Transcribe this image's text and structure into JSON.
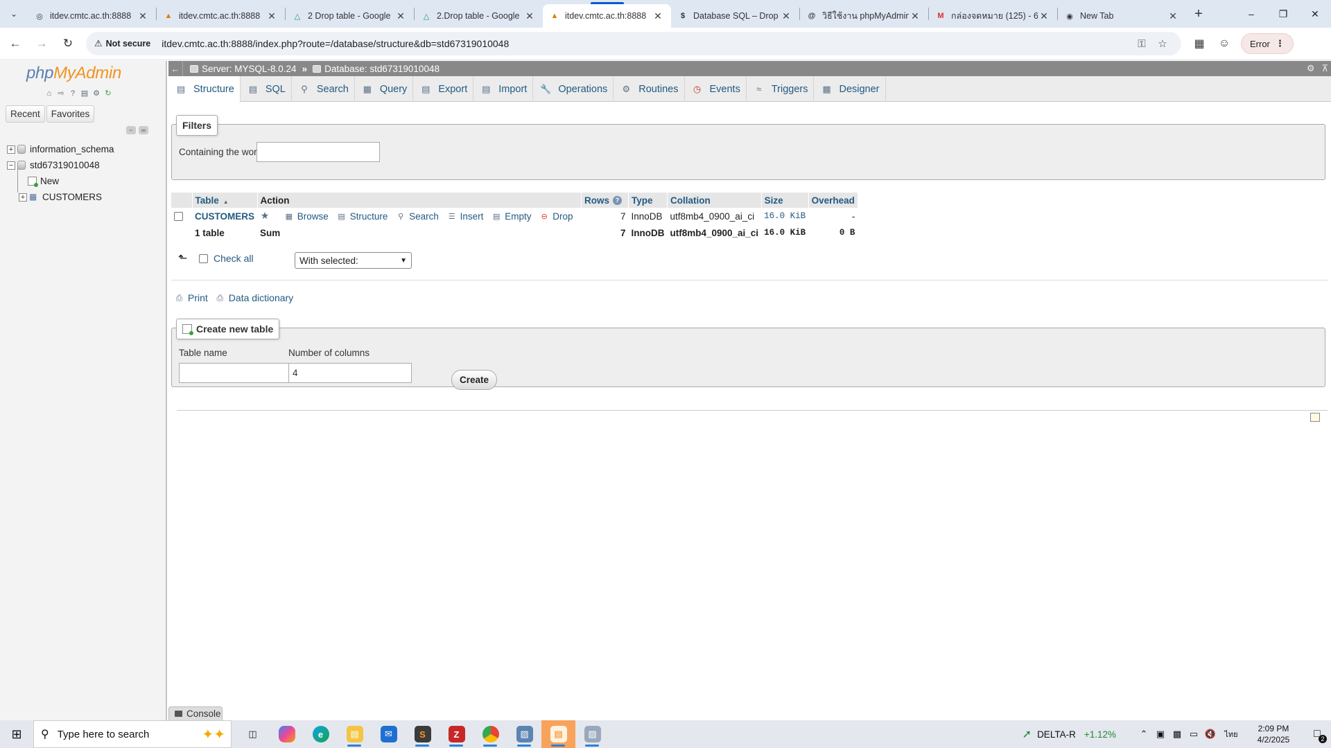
{
  "browser": {
    "tabs": [
      {
        "title": "itdev.cmtc.ac.th:8888",
        "icon": "globe-icon",
        "active": false
      },
      {
        "title": "itdev.cmtc.ac.th:8888",
        "icon": "pma-sail-icon",
        "active": false
      },
      {
        "title": "2 Drop table - Google",
        "icon": "google-drive-icon",
        "active": false
      },
      {
        "title": "2.Drop table - Google",
        "icon": "google-drive-icon",
        "active": false
      },
      {
        "title": "itdev.cmtc.ac.th:8888",
        "icon": "pma-sail-icon",
        "active": true
      },
      {
        "title": "Database SQL – Drop",
        "icon": "dollar-s-icon",
        "active": false
      },
      {
        "title": "วิธีใช้งาน phpMyAdmin",
        "icon": "threads-icon",
        "active": false
      },
      {
        "title": "กล่องจดหมาย (125) - 6",
        "icon": "gmail-icon",
        "active": false
      },
      {
        "title": "New Tab",
        "icon": "chrome-icon",
        "active": false
      }
    ],
    "security_label": "Not secure",
    "url": "itdev.cmtc.ac.th:8888/index.php?route=/database/structure&db=std67319010048",
    "error_label": "Error"
  },
  "pma": {
    "logo_php": "php",
    "logo_myadmin": "MyAdmin",
    "left_tabs": [
      "Recent",
      "Favorites"
    ],
    "tree": {
      "db1": "information_schema",
      "db2": "std67319010048",
      "new": "New",
      "table": "CUSTOMERS"
    },
    "breadcrumb": {
      "server": "Server: MYSQL-8.0.24",
      "database": "Database: std67319010048"
    },
    "menu": [
      {
        "label": "Structure",
        "icon": "structure-icon"
      },
      {
        "label": "SQL",
        "icon": "sql-icon"
      },
      {
        "label": "Search",
        "icon": "search-icon"
      },
      {
        "label": "Query",
        "icon": "query-icon"
      },
      {
        "label": "Export",
        "icon": "export-icon"
      },
      {
        "label": "Import",
        "icon": "import-icon"
      },
      {
        "label": "Operations",
        "icon": "wrench-icon"
      },
      {
        "label": "Routines",
        "icon": "routines-icon"
      },
      {
        "label": "Events",
        "icon": "clock-icon"
      },
      {
        "label": "Triggers",
        "icon": "triggers-icon"
      },
      {
        "label": "Designer",
        "icon": "designer-icon"
      }
    ],
    "filters": {
      "legend": "Filters",
      "label": "Containing the word:",
      "value": ""
    },
    "table": {
      "headers": [
        "Table",
        "Action",
        "Rows",
        "Type",
        "Collation",
        "Size",
        "Overhead"
      ],
      "row": {
        "name": "CUSTOMERS",
        "actions": [
          "Browse",
          "Structure",
          "Search",
          "Insert",
          "Empty",
          "Drop"
        ],
        "rows": "7",
        "type": "InnoDB",
        "collation": "utf8mb4_0900_ai_ci",
        "size": "16.0 KiB",
        "overhead": "-"
      },
      "footer": {
        "name": "1 table",
        "action": "Sum",
        "rows": "7",
        "type": "InnoDB",
        "collation": "utf8mb4_0900_ai_ci",
        "size": "16.0 KiB",
        "overhead": "0 B"
      },
      "check_all": "Check all",
      "with_selected": "With selected:"
    },
    "links": {
      "print": "Print",
      "data_dictionary": "Data dictionary"
    },
    "create": {
      "legend": "Create new table",
      "name_label": "Table name",
      "name_value": "",
      "cols_label": "Number of columns",
      "cols_value": "4",
      "button": "Create"
    },
    "console": "Console"
  },
  "taskbar": {
    "search_placeholder": "Type here to search",
    "stock_name": "DELTA-R",
    "stock_change": "+1.12%",
    "lang": "ไทย",
    "time": "2:09 PM",
    "date": "4/2/2025",
    "notifications": "2"
  }
}
